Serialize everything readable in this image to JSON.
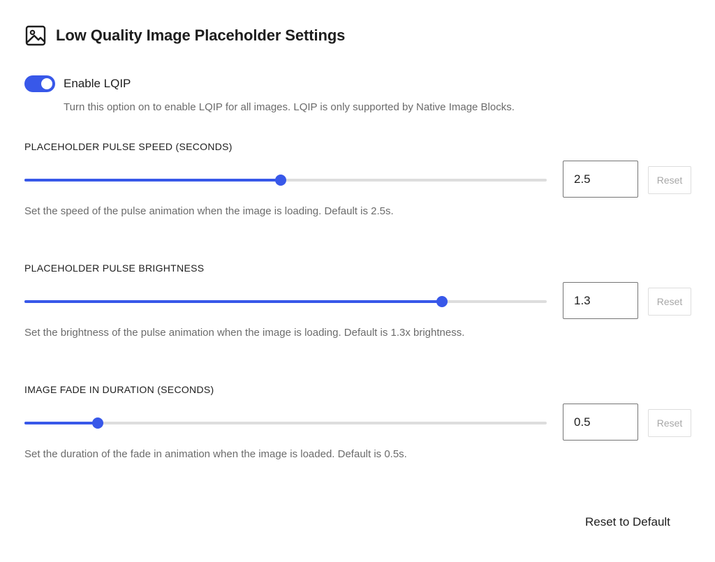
{
  "header": {
    "title": "Low Quality Image Placeholder Settings",
    "icon": "image-icon"
  },
  "colors": {
    "accent": "#3858e9",
    "track": "#dddddd"
  },
  "lqip": {
    "label": "Enable LQIP",
    "enabled": true,
    "help": "Turn this option on to enable LQIP for all images. LQIP is only supported by Native Image Blocks."
  },
  "settings": [
    {
      "title": "PLACEHOLDER PULSE SPEED (SECONDS)",
      "value": "2.5",
      "slider_fraction": 0.49,
      "reset_label": "Reset",
      "help": "Set the speed of the pulse animation when the image is loading. Default is 2.5s."
    },
    {
      "title": "PLACEHOLDER PULSE BRIGHTNESS",
      "value": "1.3",
      "slider_fraction": 0.8,
      "reset_label": "Reset",
      "help": "Set the brightness of the pulse animation when the image is loading. Default is 1.3x brightness."
    },
    {
      "title": "IMAGE FADE IN DURATION (SECONDS)",
      "value": "0.5",
      "slider_fraction": 0.14,
      "reset_label": "Reset",
      "help": "Set the duration of the fade in animation when the image is loaded. Default is 0.5s."
    }
  ],
  "footer": {
    "reset_default_label": "Reset to Default"
  }
}
